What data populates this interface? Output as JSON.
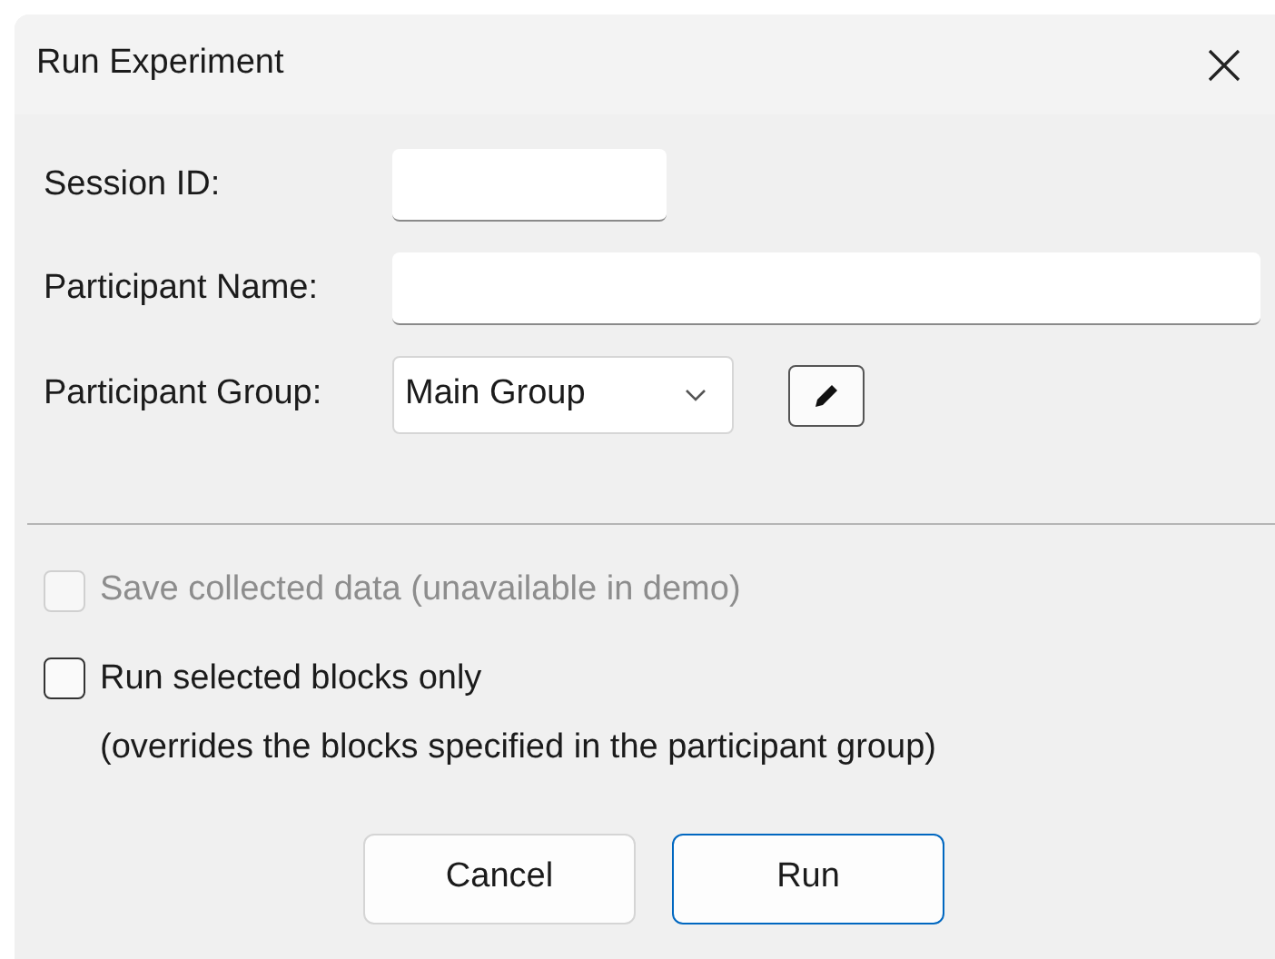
{
  "window": {
    "title": "Run Experiment"
  },
  "fields": [
    {
      "kind": "short_text",
      "label": "Session ID:"
    },
    {
      "kind": "wide_text",
      "label": "Participant Name:"
    },
    {
      "kind": "select",
      "label": "Participant Group:",
      "value": "Main Group"
    }
  ],
  "options": [
    {
      "label": "Save collected data (unavailable in demo)",
      "checked": false,
      "disabled": true
    },
    {
      "label": "Run selected blocks only",
      "checked": false,
      "disabled": false,
      "note": "(overrides the blocks specified in the participant group)"
    }
  ],
  "buttons": [
    {
      "label": "Cancel",
      "default": false
    },
    {
      "label": "Run",
      "default": true
    }
  ]
}
